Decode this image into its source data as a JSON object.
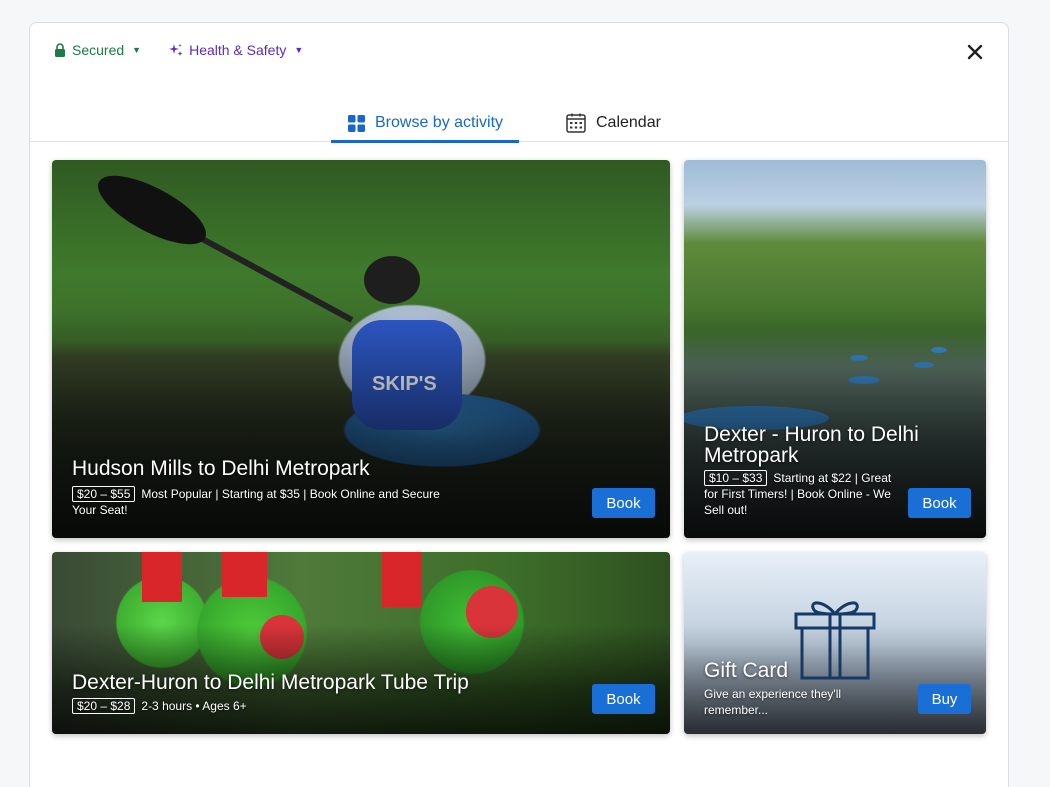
{
  "topbar": {
    "secured_label": "Secured",
    "health_label": "Health & Safety",
    "secured_color": "#1f7a44",
    "health_color": "#5b2bc1"
  },
  "tabs": [
    {
      "label": "Browse by activity",
      "icon": "grid-icon",
      "active": true
    },
    {
      "label": "Calendar",
      "icon": "calendar-icon",
      "active": false
    }
  ],
  "accent_color": "#1a67c9",
  "cards": [
    {
      "title": "Hudson Mills to Delhi Metropark",
      "price": "$20 – $55",
      "description": "Most Popular | Starting at $35 | Book Online and Secure Your Seat!",
      "button": "Book"
    },
    {
      "title": "Dexter - Huron to Delhi Metropark",
      "price": "$10 – $33",
      "description": "Starting at $22 | Great for First Timers! | Book Online - We Sell out!",
      "button": "Book"
    },
    {
      "title": "Dexter-Huron to Delhi Metropark Tube Trip",
      "price": "$20 – $28",
      "description": "2-3 hours • Ages 6+",
      "button": "Book"
    },
    {
      "title": "Gift Card",
      "description": "Give an experience they'll remember...",
      "button": "Buy",
      "icon": "gift-icon"
    }
  ]
}
